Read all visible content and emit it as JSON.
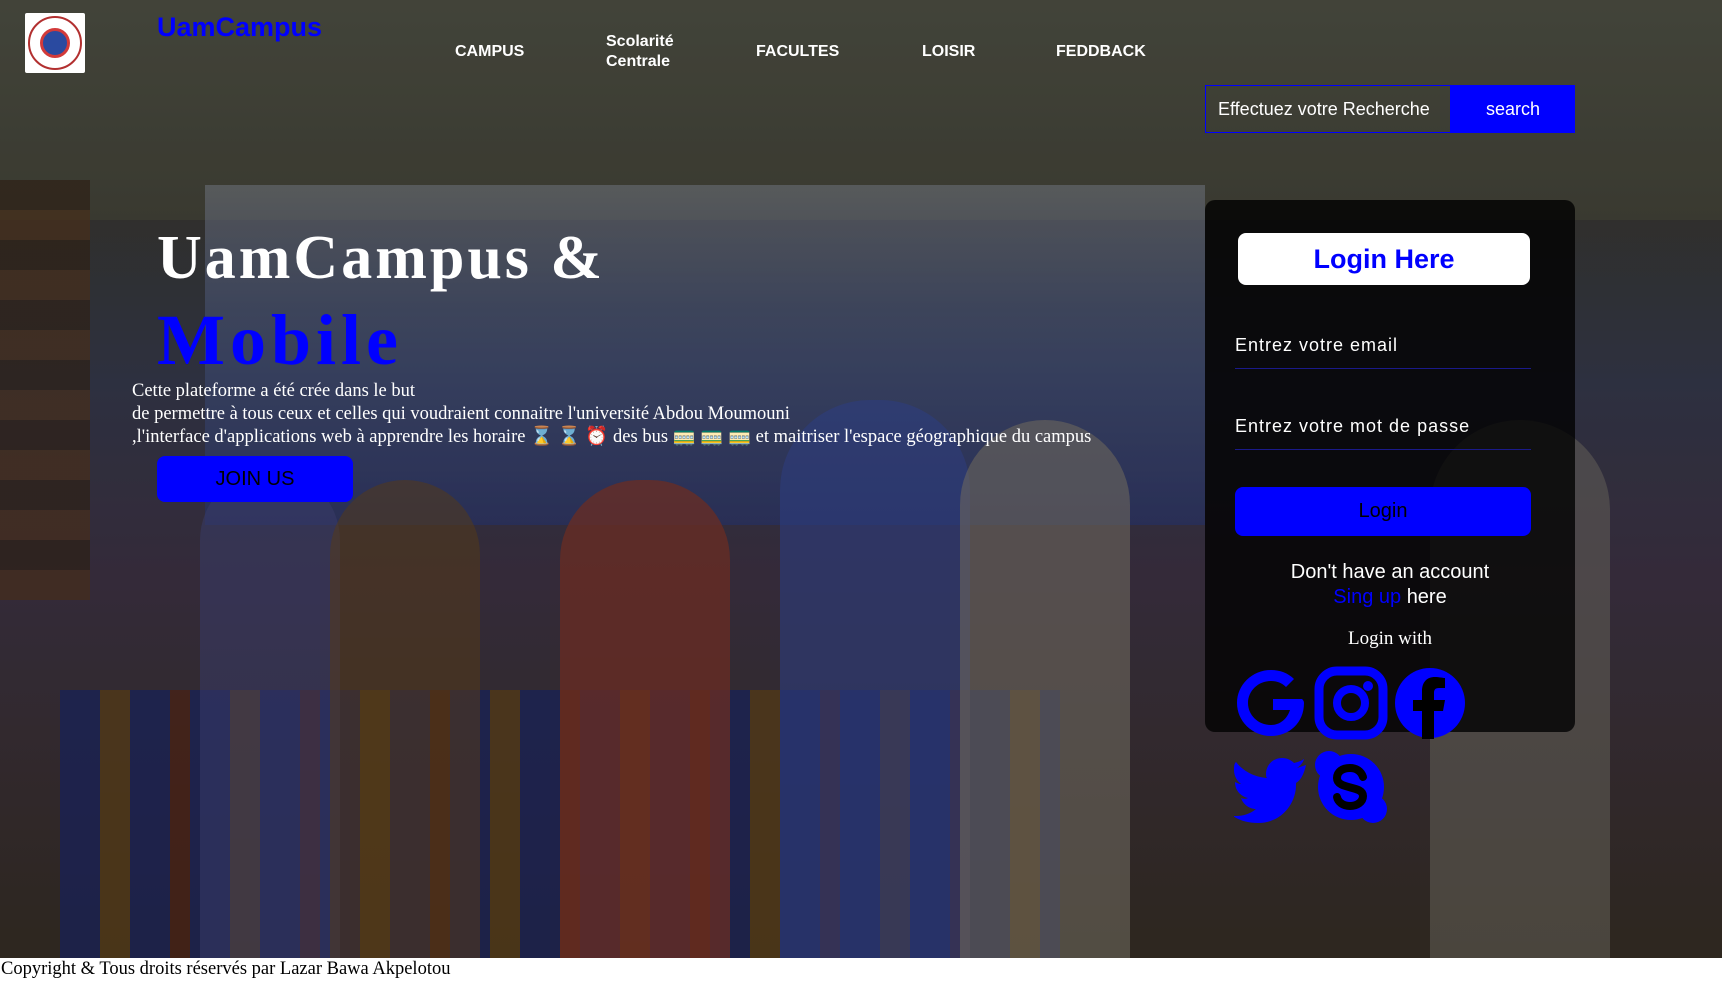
{
  "brand": {
    "name": "UamCampus"
  },
  "nav": {
    "items": [
      {
        "label": "CAMPUS"
      },
      {
        "label_line1": "Scolarité",
        "label_line2": "Centrale"
      },
      {
        "label": "FACULTES"
      },
      {
        "label": "LOISIR"
      },
      {
        "label": "FEDDBACK"
      }
    ]
  },
  "search": {
    "placeholder": "Effectuez votre Recherche",
    "button_label": "search"
  },
  "hero": {
    "title": "UamCampus &",
    "subtitle": "Mobile",
    "description": [
      "Cette plateforme a été crée dans le but",
      "de permettre à tous ceux et celles qui voudraient connaitre l'université Abdou Moumouni",
      ",l'interface d'applications web à apprendre les horaire ⌛ ⌛ ⏰ des bus 🚃 🚃 🚃 et maitriser l'espace géographique du campus"
    ],
    "join_label": "JOIN US"
  },
  "login": {
    "title": "Login Here",
    "email_placeholder": "Entrez votre email",
    "password_placeholder": "Entrez votre mot de passe",
    "button_label": "Login",
    "no_account": "Don't have an account",
    "signup_link": "Sing up",
    "signup_suffix": "here",
    "login_with": "Login with"
  },
  "social": [
    {
      "icon": "google-icon"
    },
    {
      "icon": "instagram-icon"
    },
    {
      "icon": "facebook-icon"
    },
    {
      "icon": "twitter-icon"
    },
    {
      "icon": "skype-icon"
    }
  ],
  "colors": {
    "accent": "#0000ff",
    "text": "#ffffff",
    "panel": "#000000"
  },
  "footer": {
    "text": "Copyright & Tous droits réservés par Lazar Bawa Akpelotou"
  }
}
